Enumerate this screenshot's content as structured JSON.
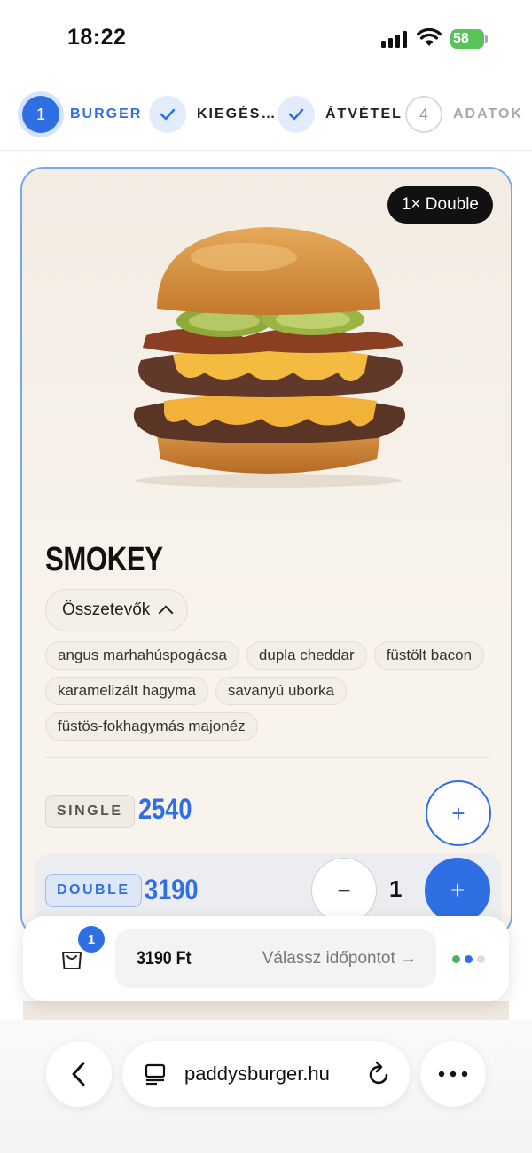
{
  "status_bar": {
    "time": "18:22",
    "battery": "58"
  },
  "stepper": [
    {
      "number": "1",
      "label": "BURGER",
      "state": "active"
    },
    {
      "number": "",
      "label": "KIEGÉS…",
      "state": "done"
    },
    {
      "number": "",
      "label": "ÁTVÉTEL",
      "state": "done"
    },
    {
      "number": "4",
      "label": "ADATOK",
      "state": "todo"
    }
  ],
  "product": {
    "badge": "1× Double",
    "name": "SMOKEY",
    "ingredients_toggle": "Összetevők",
    "ingredients": [
      "angus marhahúspogácsa",
      "dupla cheddar",
      "füstölt bacon",
      "karamelizált hagyma",
      "savanyú uborka",
      "füstös-fokhagymás majonéz"
    ],
    "sizes": [
      {
        "label": "SINGLE",
        "price": "2540",
        "selected": false
      },
      {
        "label": "DOUBLE",
        "price": "3190",
        "selected": true,
        "quantity": "1"
      }
    ]
  },
  "cart": {
    "count": "1",
    "total": "3190 Ft",
    "cta": "Válassz időpontot →"
  },
  "browser": {
    "url": "paddysburger.hu"
  },
  "colors": {
    "accent": "#2f6fe4",
    "card_border": "#7aa6ec",
    "card_bg": "#f8f3ec"
  },
  "icons": [
    "signal-icon",
    "wifi-icon",
    "battery-icon",
    "check-icon",
    "chevron-up-icon",
    "minus-icon",
    "plus-icon",
    "shopping-bag-icon",
    "back-icon",
    "reader-icon",
    "reload-icon",
    "more-icon"
  ]
}
